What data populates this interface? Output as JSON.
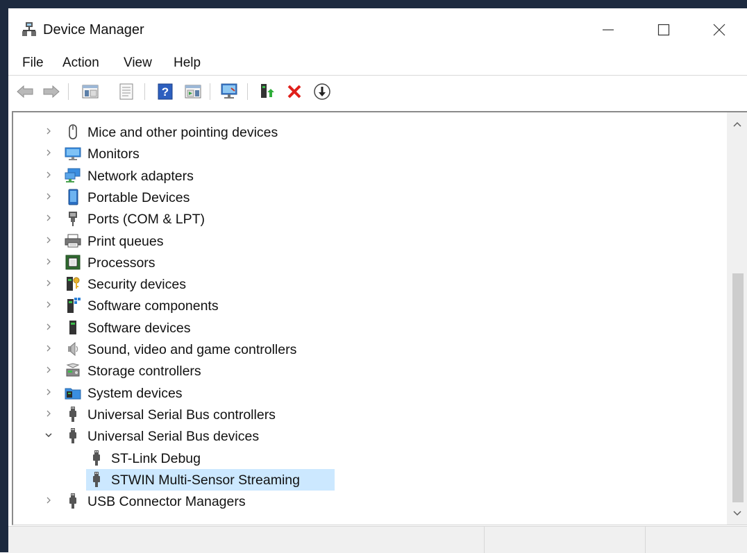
{
  "window": {
    "title": "Device Manager",
    "icon": "device-manager-icon",
    "controls": [
      "minimize-icon",
      "maximize-icon",
      "close-icon"
    ]
  },
  "menu": [
    "File",
    "Action",
    "View",
    "Help"
  ],
  "toolbar": [
    {
      "name": "back-button",
      "icon": "back-arrow-icon"
    },
    {
      "name": "forward-button",
      "icon": "forward-arrow-icon"
    },
    {
      "name": "show-hide-console-tree-button",
      "icon": "console-tree-icon"
    },
    {
      "name": "properties-button",
      "icon": "properties-icon"
    },
    {
      "name": "help-button",
      "icon": "help-icon"
    },
    {
      "name": "show-action-pane-button",
      "icon": "action-pane-icon"
    },
    {
      "name": "scan-hardware-button",
      "icon": "monitor-scan-icon"
    },
    {
      "name": "update-driver-button",
      "icon": "update-driver-icon"
    },
    {
      "name": "uninstall-device-button",
      "icon": "red-x-icon"
    },
    {
      "name": "disable-device-button",
      "icon": "down-arrow-circle-icon"
    }
  ],
  "tree": [
    {
      "label": "Mice and other pointing devices",
      "icon": "mouse-icon",
      "expanded": false,
      "level": 0
    },
    {
      "label": "Monitors",
      "icon": "monitor-icon",
      "expanded": false,
      "level": 0
    },
    {
      "label": "Network adapters",
      "icon": "network-icon",
      "expanded": false,
      "level": 0
    },
    {
      "label": "Portable Devices",
      "icon": "portable-device-icon",
      "expanded": false,
      "level": 0
    },
    {
      "label": "Ports (COM & LPT)",
      "icon": "port-icon",
      "expanded": false,
      "level": 0
    },
    {
      "label": "Print queues",
      "icon": "printer-icon",
      "expanded": false,
      "level": 0
    },
    {
      "label": "Processors",
      "icon": "processor-icon",
      "expanded": false,
      "level": 0
    },
    {
      "label": "Security devices",
      "icon": "security-key-icon",
      "expanded": false,
      "level": 0
    },
    {
      "label": "Software components",
      "icon": "software-component-icon",
      "expanded": false,
      "level": 0
    },
    {
      "label": "Software devices",
      "icon": "software-device-icon",
      "expanded": false,
      "level": 0
    },
    {
      "label": "Sound, video and game controllers",
      "icon": "speaker-icon",
      "expanded": false,
      "level": 0
    },
    {
      "label": "Storage controllers",
      "icon": "storage-icon",
      "expanded": false,
      "level": 0
    },
    {
      "label": "System devices",
      "icon": "system-folder-icon",
      "expanded": false,
      "level": 0
    },
    {
      "label": "Universal Serial Bus controllers",
      "icon": "usb-icon",
      "expanded": false,
      "level": 0
    },
    {
      "label": "Universal Serial Bus devices",
      "icon": "usb-icon",
      "expanded": true,
      "level": 0
    },
    {
      "label": "ST-Link Debug",
      "icon": "usb-icon",
      "level": 1
    },
    {
      "label": "STWIN Multi-Sensor Streaming",
      "icon": "usb-icon",
      "level": 1,
      "selected": true
    },
    {
      "label": "USB Connector Managers",
      "icon": "usb-icon",
      "expanded": false,
      "level": 0
    }
  ],
  "scrollbar": {
    "up_icon": "chevron-up-icon",
    "down_icon": "chevron-down-icon"
  },
  "colors": {
    "selection": "#cce8ff",
    "desktop": "#1d2a3f",
    "statusbar": "#f0f0f0"
  }
}
